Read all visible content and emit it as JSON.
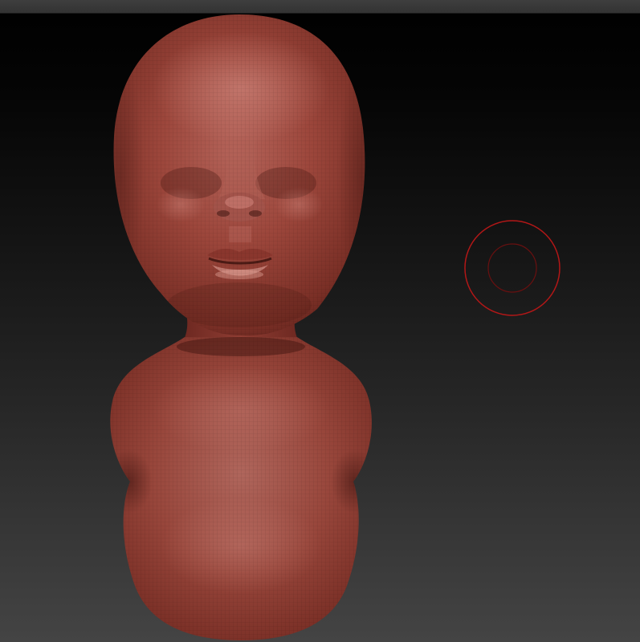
{
  "viewport": {
    "background_top": "#000000",
    "background_bottom": "#444444",
    "top_bar_color": "#3a3a3a"
  },
  "model": {
    "material_color": "#8f3a30",
    "highlight_color": "#c4746a",
    "shadow_color": "#4a1a15",
    "wireframe_visible": true,
    "shape": "sculpted head and body"
  },
  "brush": {
    "icon": "brush-draw-size-circle",
    "stroke_color": "#b31717"
  }
}
